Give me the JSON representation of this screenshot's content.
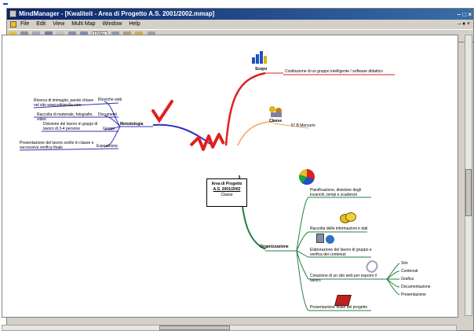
{
  "window": {
    "title": "MindManager - [Kwaliteit - Area di Progetto A.S. 2001/2002.mmap]",
    "controls": "– □ ×"
  },
  "menubar": {
    "items": [
      "File",
      "Edit",
      "View",
      "Multi Map",
      "Window",
      "Help"
    ],
    "mdi_controls": "– ♦ ×"
  },
  "toolbar": {
    "zoom_value": "100%"
  },
  "mindmap": {
    "central": {
      "line1": "Area di Progetto",
      "line2": "A.S. 2001/2002",
      "line3": "Classe"
    },
    "branches": {
      "scopo": {
        "label": "Scopo",
        "text": "Costituzione di un gruppo intelligente / software didattico",
        "color": "#e02020"
      },
      "classe": {
        "label": "Classe",
        "text": "5^ B Mercurio",
        "color": "#f0a060"
      },
      "metodologia": {
        "label": "Metodologia",
        "color": "#3030c0",
        "items": [
          {
            "label": "Ricerche web",
            "text": "Ricerca di immagini, parole chiave nel sito www.wikipedia.com"
          },
          {
            "label": "Documenti",
            "text": "Raccolta di materiale, fotografie, video"
          },
          {
            "label": "Gruppi",
            "text": "Divisione del lavoro in gruppi di lavoro di 3-4 persone"
          },
          {
            "label": "Esposizione",
            "text": "Presentazione del lavoro svolto in classe e successiva verifica finale"
          }
        ]
      },
      "organizzazione": {
        "label": "Organizzazione",
        "color": "#208040",
        "items": [
          {
            "text": "Pianificazione, divisione degli incarichi, tempi e scadenze"
          },
          {
            "text": "Raccolta delle informazioni e dati"
          },
          {
            "text": "Elaborazione del lavoro di gruppo e verifica dei contenuti"
          },
          {
            "text": "Creazione di un sito web per esporre il lavoro"
          },
          {
            "text": "Presentazione finale del progetto"
          }
        ],
        "sub_items": [
          "Sito",
          "Contenuti",
          "Grafica",
          "Documentazione",
          "Presentazione"
        ]
      }
    }
  }
}
